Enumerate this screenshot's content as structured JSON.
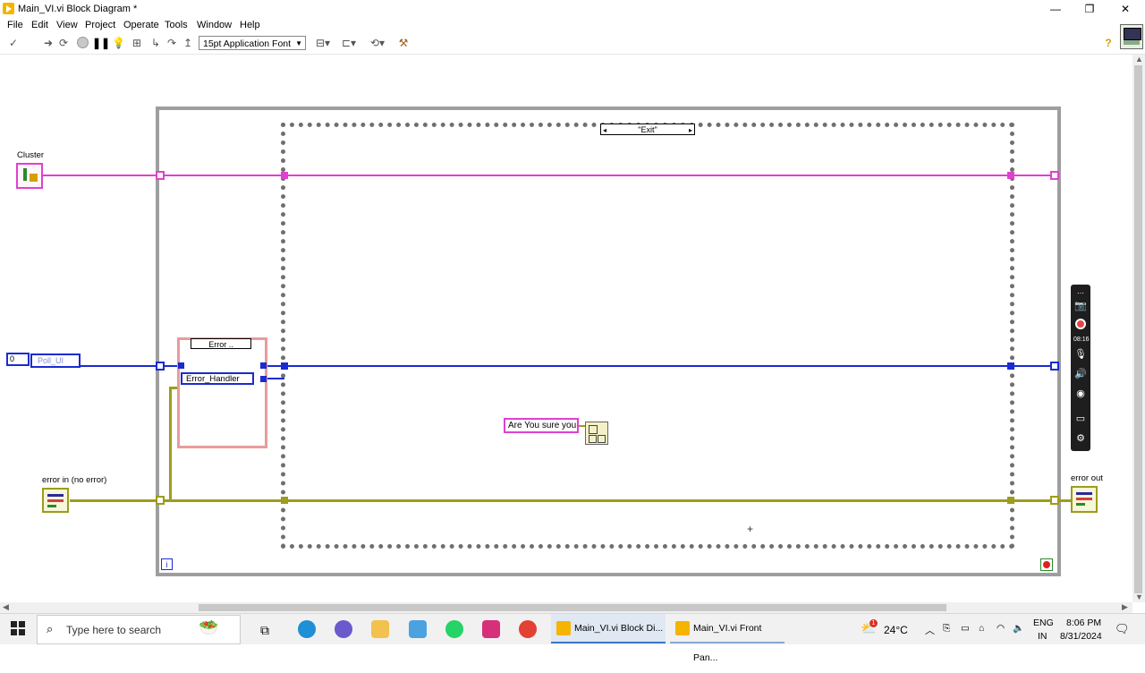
{
  "window": {
    "title": "Main_VI.vi Block Diagram *",
    "controls": {
      "minimize": "—",
      "maximize": "❐",
      "close": "✕"
    }
  },
  "menu": [
    "File",
    "Edit",
    "View",
    "Project",
    "Operate",
    "Tools",
    "Window",
    "Help"
  ],
  "toolbar": {
    "font_select": "15pt Application Font",
    "icons": [
      "check-icon",
      "run-icon",
      "run-continuously-icon",
      "abort-icon",
      "pause-icon",
      "highlight-execution-icon",
      "retain-wire-values-icon",
      "step-into-icon",
      "step-over-icon",
      "step-out-icon",
      "align-icon",
      "distribute-icon",
      "reorder-icon",
      "clean-up-icon",
      "help-icon"
    ]
  },
  "diagram": {
    "cluster_label": "Cluster",
    "case_selector": "\"Exit\"",
    "inner_case_selector": "Error ..",
    "enum_constant": "Error_Handler",
    "numeric_constant": "0",
    "poll_constant": "Poll_UI",
    "string_constant": "Are You sure you",
    "error_in_label": "error in (no error)",
    "error_out_label": "error out",
    "loop_iteration": "i"
  },
  "recorder": {
    "time": "08:16"
  },
  "taskbar": {
    "search_placeholder": "Type here to search",
    "windows": [
      "Main_VI.vi Block Di...",
      "Main_VI.vi Front Pan..."
    ],
    "weather": "24°C",
    "lang_line1": "ENG",
    "lang_line2": "IN",
    "time": "8:06 PM",
    "date": "8/31/2024",
    "notification_count": "1"
  },
  "colors": {
    "string_wire": "#e040d0",
    "enum_wire": "#1a2bd1",
    "error_wire": "#9c9c1e"
  }
}
